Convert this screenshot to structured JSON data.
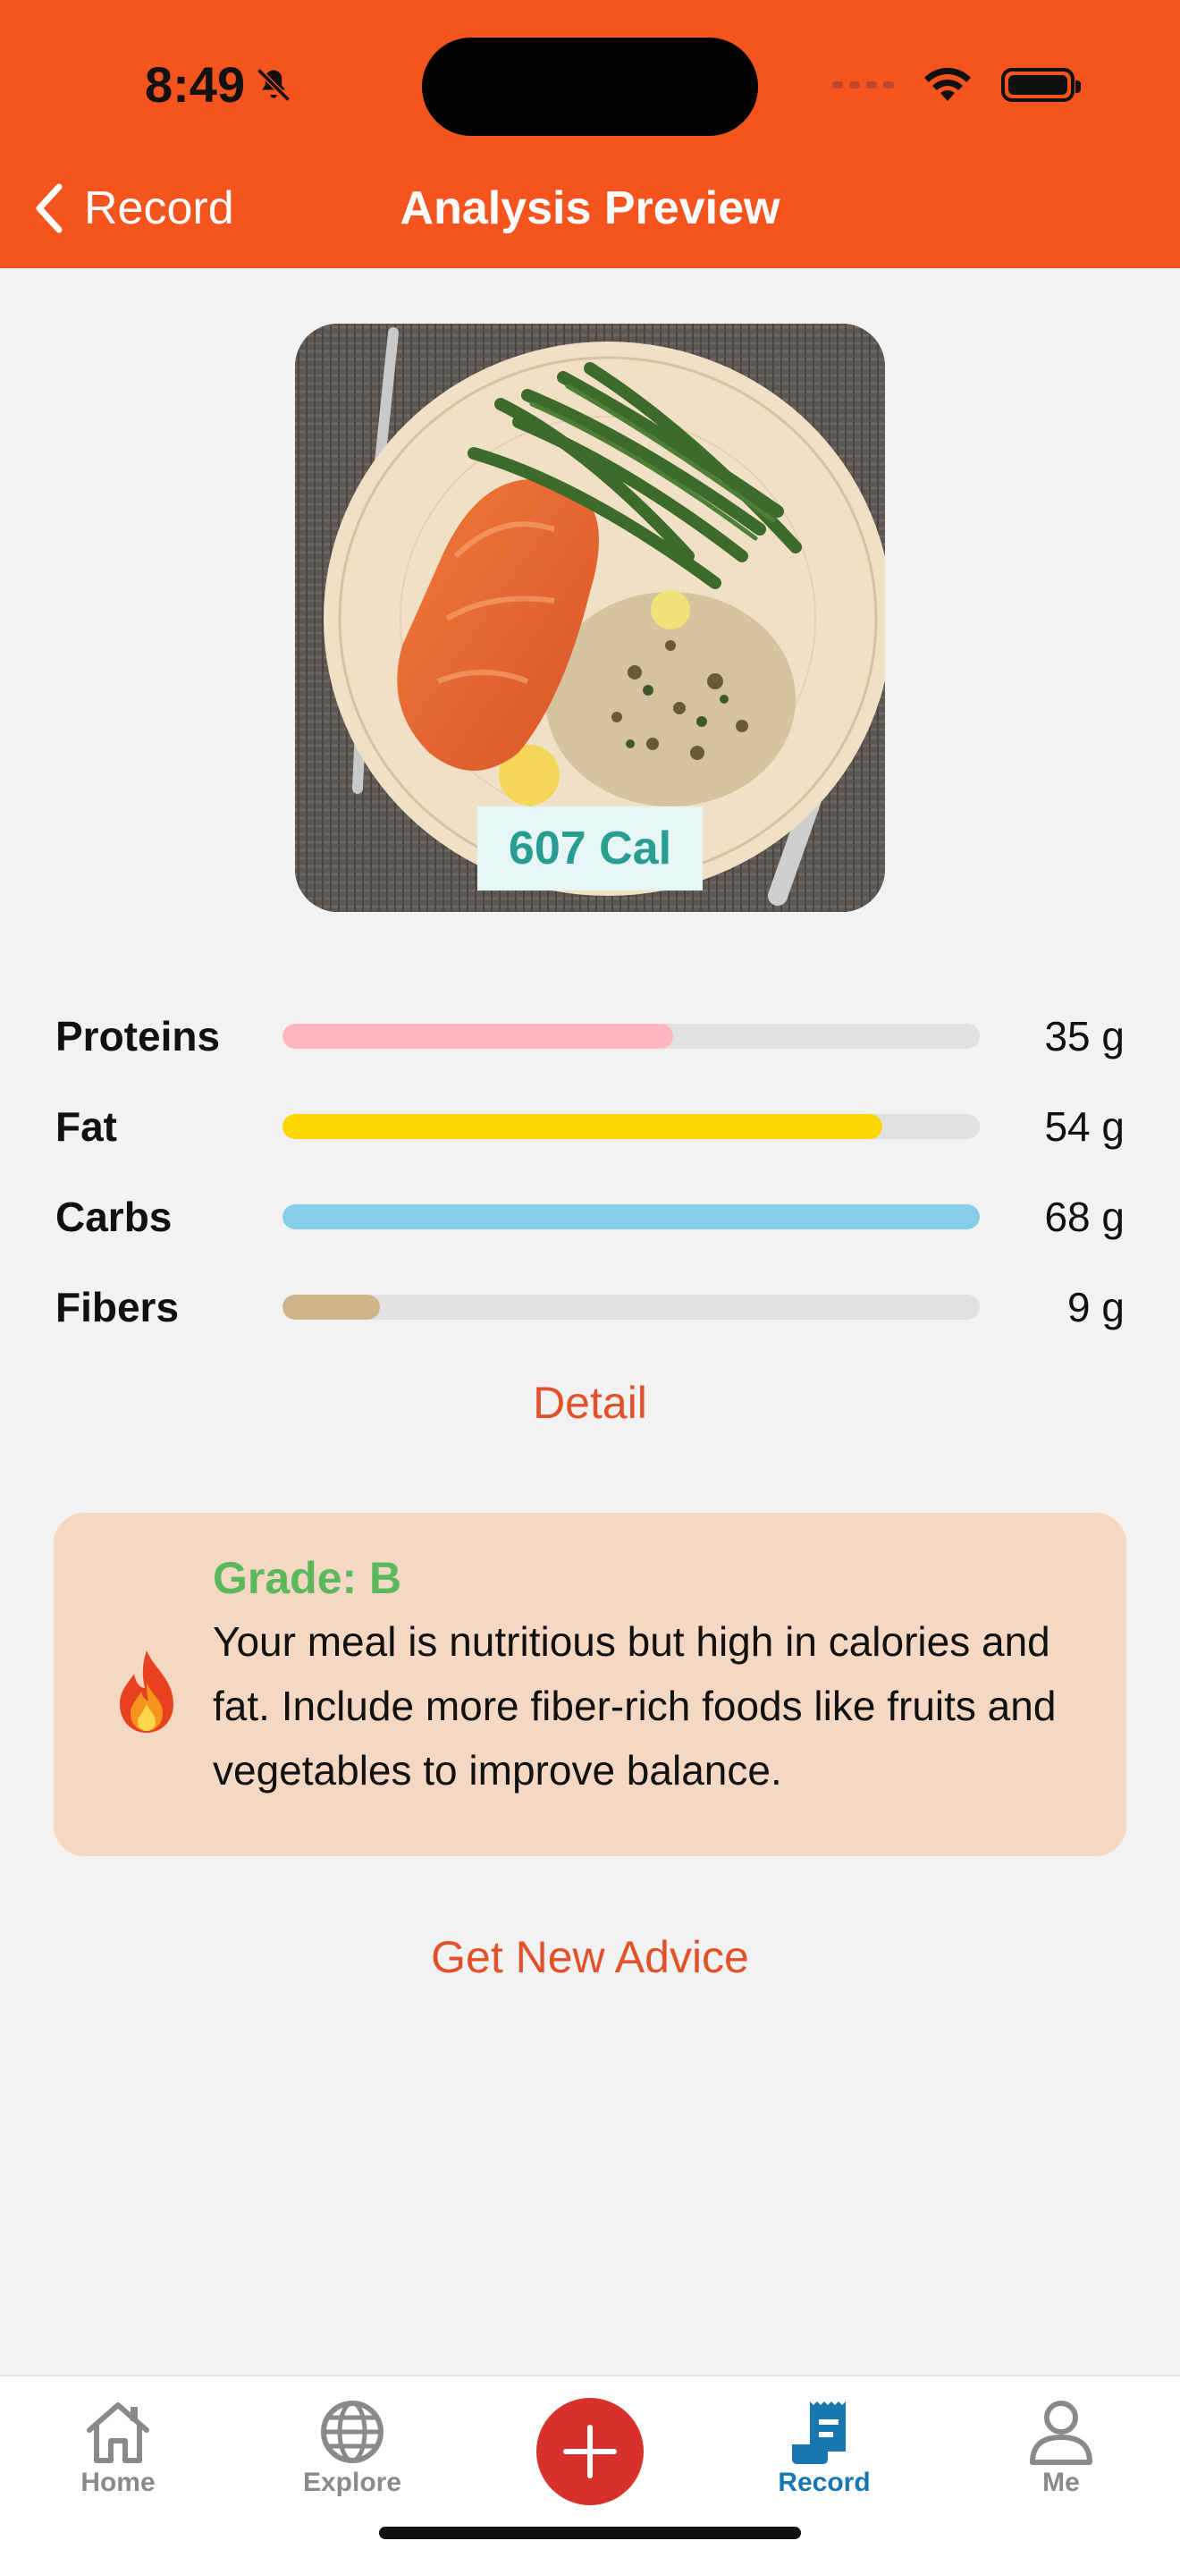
{
  "status_bar": {
    "time": "8:49"
  },
  "nav": {
    "back_label": "Record",
    "title": "Analysis Preview"
  },
  "meal": {
    "calories_label": "607 Cal"
  },
  "nutrients": [
    {
      "label": "Proteins",
      "value": "35 g",
      "fraction": 0.56,
      "color": "#ffb6c1"
    },
    {
      "label": "Fat",
      "value": "54 g",
      "fraction": 0.86,
      "color": "#ffd700"
    },
    {
      "label": "Carbs",
      "value": "68 g",
      "fraction": 1.0,
      "color": "#87ceeb"
    },
    {
      "label": "Fibers",
      "value": "9 g",
      "fraction": 0.14,
      "color": "#d2b48c"
    }
  ],
  "detail_label": "Detail",
  "advice": {
    "grade": "Grade: B",
    "text": "Your meal is nutritious but high in calories and fat. Include more fiber-rich foods like fruits and vegetables to improve balance."
  },
  "new_advice_label": "Get New Advice",
  "tabs": {
    "home": "Home",
    "explore": "Explore",
    "record": "Record",
    "me": "Me"
  },
  "colors": {
    "accent": "#f5541f",
    "link": "#e2522a",
    "active_tab": "#1877b0",
    "add_button": "#d8312b",
    "grade": "#5cb85c"
  }
}
